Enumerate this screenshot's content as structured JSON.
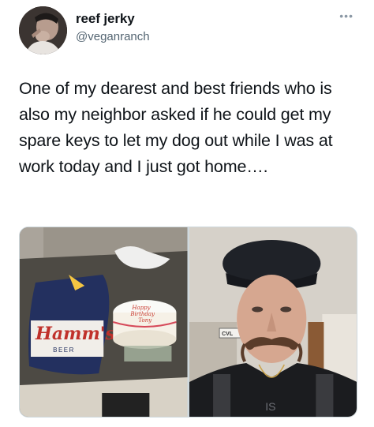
{
  "tweet": {
    "display_name": "reef jerky",
    "handle": "@veganranch",
    "more_icon": "more-horizontal-icon",
    "text": "One of my dearest and best friends who is also my neighbor asked if he could get my spare keys to let my dog out while I was at work today and I just got home…."
  },
  "media": {
    "photo_left": {
      "cake_lines": [
        "Happy",
        "Birthday",
        "Tony"
      ],
      "sweater_brand": "Hamm's",
      "sweater_sub": "BEER"
    },
    "photo_right": {
      "sign_text": "CVL",
      "shirt_text": "IS"
    }
  },
  "colors": {
    "text_primary": "#0f1419",
    "text_secondary": "#536471",
    "border": "#cfd9de"
  }
}
